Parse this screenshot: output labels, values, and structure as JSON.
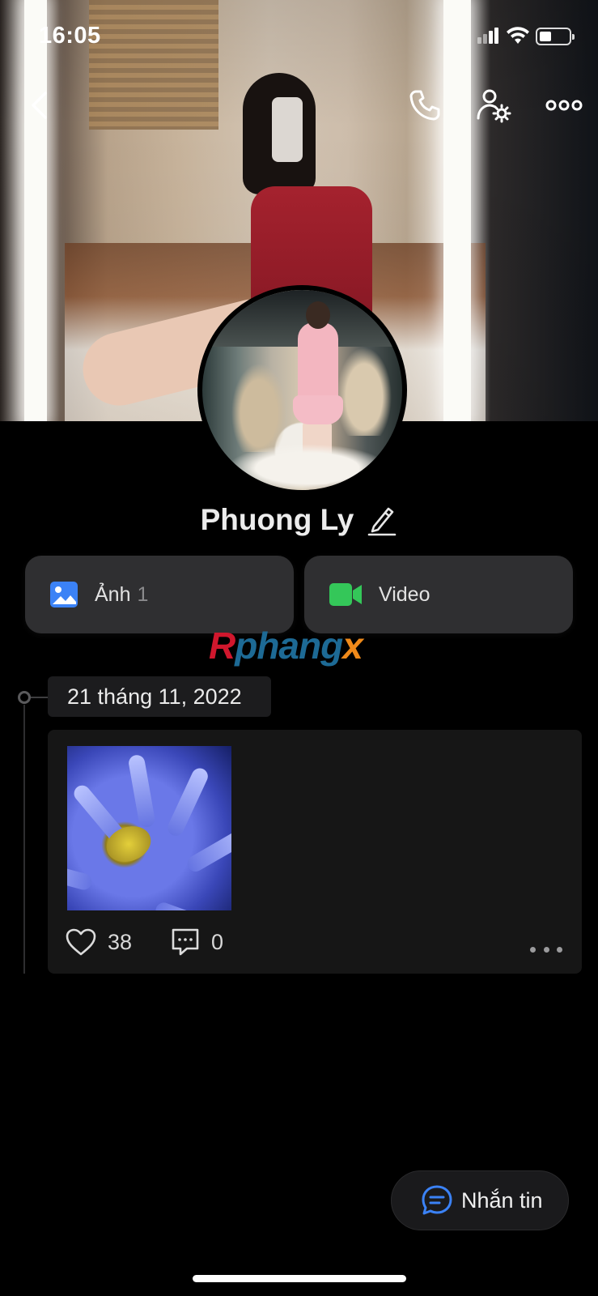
{
  "status_bar": {
    "time": "16:05"
  },
  "cover": {
    "image_desc": "cover-photo"
  },
  "profile": {
    "name": "Phuong Ly"
  },
  "media_tabs": [
    {
      "label": "Ảnh",
      "count": "1",
      "icon": "image-icon",
      "color": "#3b82f6"
    },
    {
      "label": "Video",
      "icon": "video-camera-icon",
      "color": "#34c759"
    }
  ],
  "watermark": {
    "part1": "R",
    "part2": "phang",
    "part3": "x"
  },
  "timeline": {
    "date": "21 tháng 11, 2022"
  },
  "post": {
    "likes": "38",
    "comments": "0"
  },
  "message_button": {
    "label": "Nhắn tin",
    "color": "#3b82f6"
  }
}
